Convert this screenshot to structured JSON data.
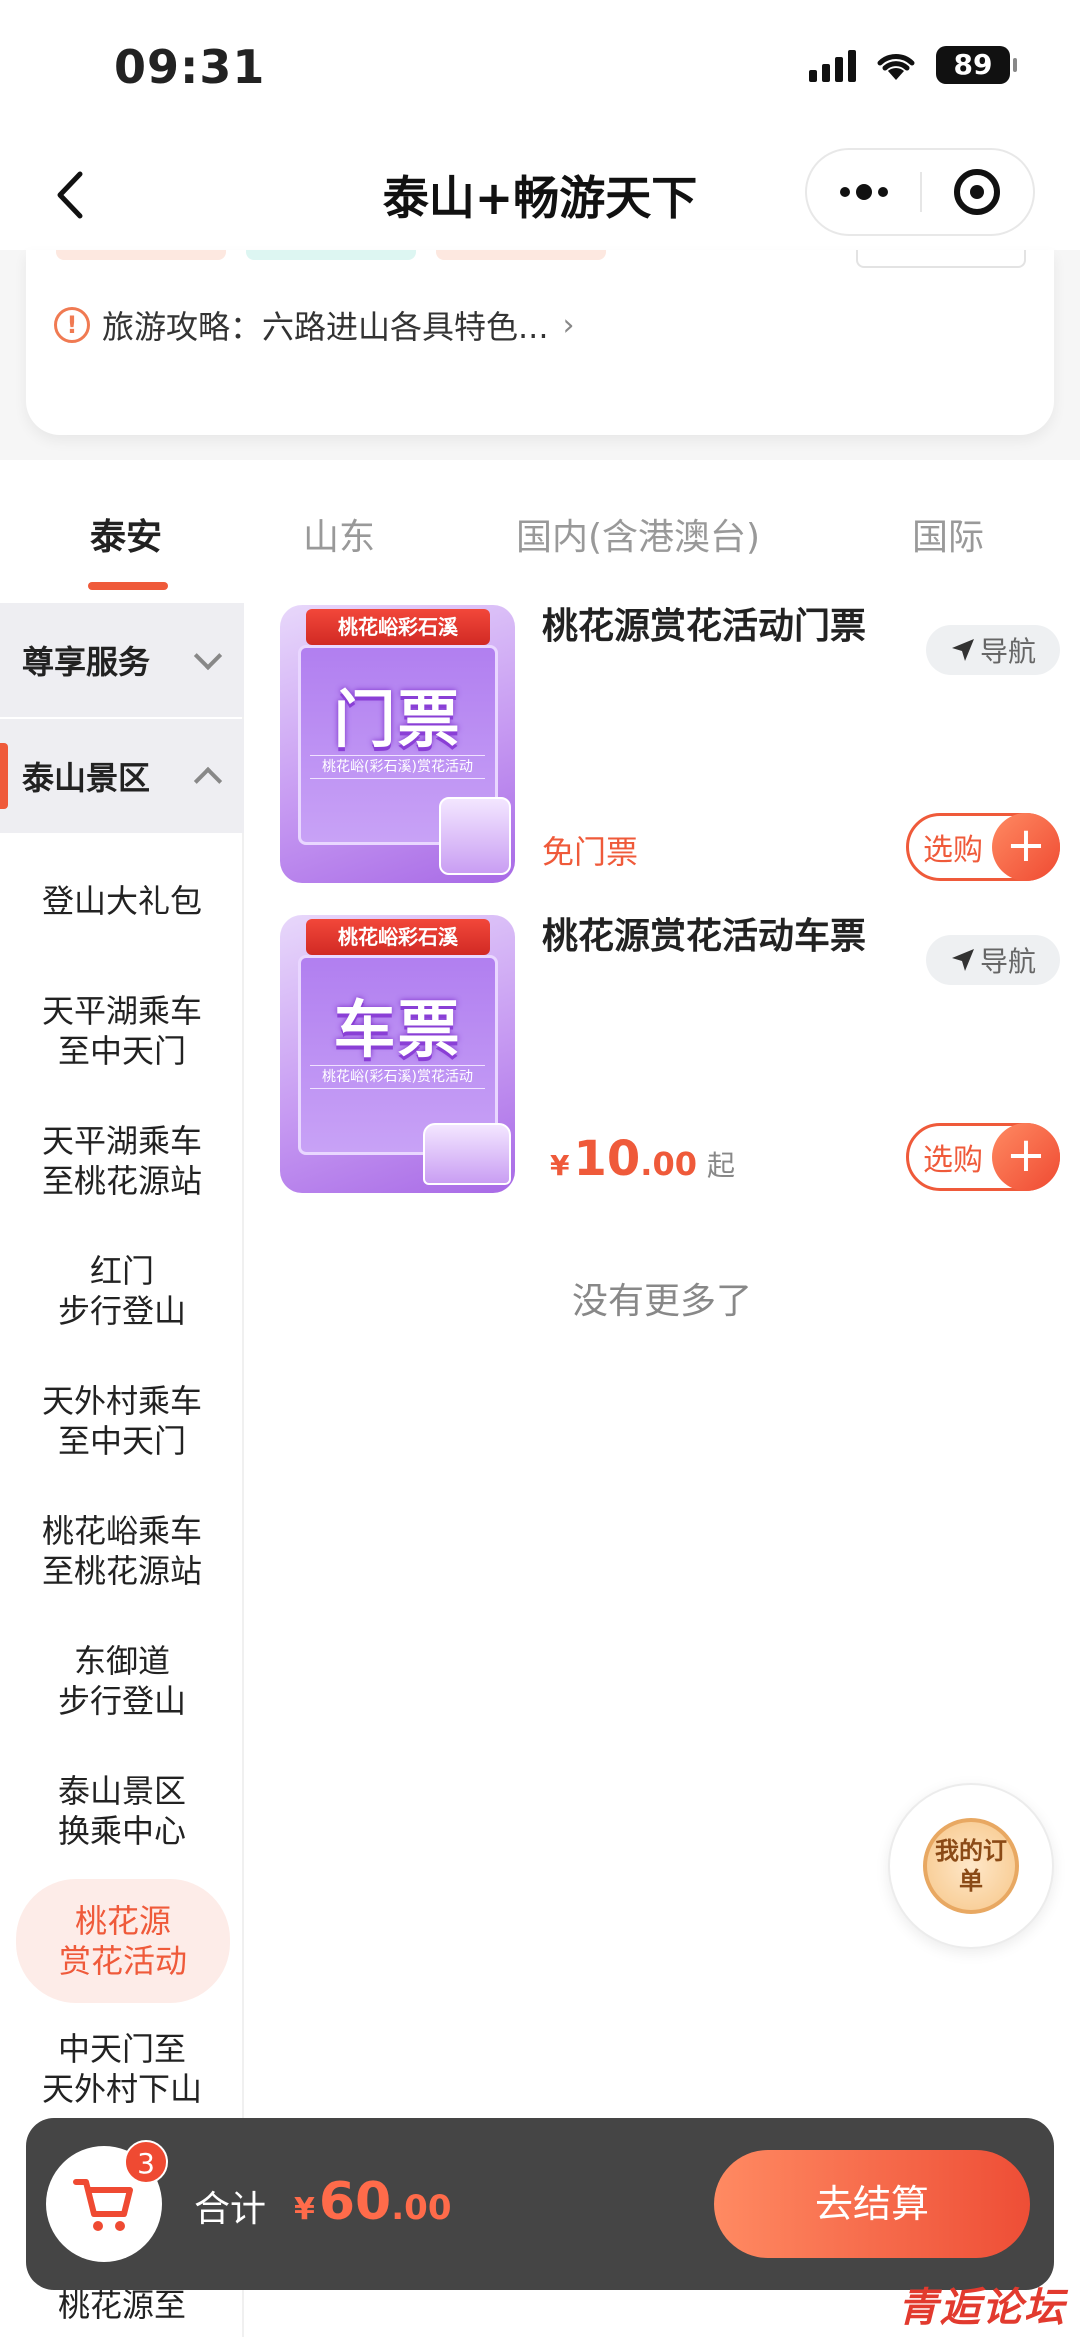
{
  "status": {
    "time": "09:31",
    "battery": "89"
  },
  "nav": {
    "title": "泰山+畅游天下"
  },
  "guide": {
    "text": "旅游攻略：六路进山各具特色...",
    "arrow": "›"
  },
  "tabs": [
    {
      "label": "泰安",
      "active": true
    },
    {
      "label": "山东",
      "active": false
    },
    {
      "label": "国内(含港澳台)",
      "active": false
    },
    {
      "label": "国际",
      "active": false
    }
  ],
  "sidebar": {
    "groups": [
      {
        "label": "尊享服务",
        "expanded": false
      },
      {
        "label": "泰山景区",
        "expanded": true
      }
    ],
    "items": [
      {
        "line1": "登山大礼包",
        "line2": ""
      },
      {
        "line1": "天平湖乘车",
        "line2": "至中天门"
      },
      {
        "line1": "天平湖乘车",
        "line2": "至桃花源站"
      },
      {
        "line1": "红门",
        "line2": "步行登山"
      },
      {
        "line1": "天外村乘车",
        "line2": "至中天门"
      },
      {
        "line1": "桃花峪乘车",
        "line2": "至桃花源站"
      },
      {
        "line1": "东御道",
        "line2": "步行登山"
      },
      {
        "line1": "泰山景区",
        "line2": "换乘中心"
      },
      {
        "line1": "桃花源",
        "line2": "赏花活动",
        "active": true
      },
      {
        "line1": "中天门至",
        "line2": "天外村下山"
      },
      {
        "line1": "桃花源至",
        "line2": ""
      }
    ]
  },
  "products": [
    {
      "name": "桃花源赏花活动门票",
      "thumb_ribbon": "桃花峪彩石溪",
      "thumb_title": "门票",
      "thumb_sub": "桃花峪(彩石溪)赏花活动",
      "nav_label": "导航",
      "price_label": "免门票",
      "buy_label": "选购"
    },
    {
      "name": "桃花源赏花活动车票",
      "thumb_ribbon": "桃花峪彩石溪",
      "thumb_title": "车票",
      "thumb_sub": "桃花峪(彩石溪)赏花活动",
      "nav_label": "导航",
      "price_yen": "¥",
      "price_int": "10",
      "price_dec": ".00",
      "price_suffix": "起",
      "buy_label": "选购"
    }
  ],
  "no_more": "没有更多了",
  "order_fab": {
    "label": "我的订单"
  },
  "checkout": {
    "cart_count": "3",
    "total_label": "合计",
    "yen": "¥",
    "total_int": "60",
    "total_dec": ".00",
    "button": "去结算"
  },
  "watermark": "青逅论坛",
  "colors": {
    "accent": "#ef5a3a",
    "bar": "#454545",
    "purple": "#a86ae6"
  }
}
